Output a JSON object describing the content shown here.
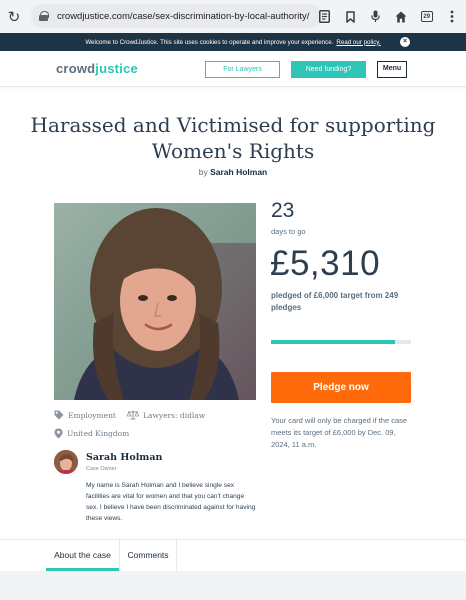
{
  "browser": {
    "url": "crowdjustice.com/case/sex-discrimination-by-local-authority/",
    "tab_count": "29"
  },
  "cookie_bar": {
    "text": "Welcome to CrowdJustice. This site uses cookies to operate and improve your experience.",
    "link": "Read our policy."
  },
  "header": {
    "logo_part1": "crowd",
    "logo_part2": "justice",
    "lawyers_button": "For Lawyers",
    "funding_button": "Need funding?",
    "menu_button": "Menu"
  },
  "campaign": {
    "title": "Harassed and Victimised for supporting Women's Rights",
    "by_prefix": "by",
    "author": "Sarah Holman",
    "days_to_go": "23",
    "days_label": "days to go",
    "amount_raised": "£5,310",
    "pledged_text": "pledged of £6,000 target from 249 pledges",
    "progress_fraction": 0.885,
    "pledge_button": "Pledge now",
    "charge_note": "Your card will only be charged if the case meets its target of £6,000 by Dec. 09, 2024, 11 a.m."
  },
  "meta": {
    "category": "Employment",
    "lawyers": "Lawyers: didlaw",
    "location": "United Kingdom"
  },
  "owner": {
    "name": "Sarah Holman",
    "role": "Case Owner",
    "description": "My name is Sarah Holman and I believe single sex facilities are vital for women and that you can't change sex. I believe I have been discriminated against for having these views."
  },
  "tabs": {
    "about": "About the case",
    "comments": "Comments"
  },
  "colors": {
    "teal": "#2ec4b6",
    "orange": "#ff6b0a",
    "navy": "#1d3447"
  }
}
